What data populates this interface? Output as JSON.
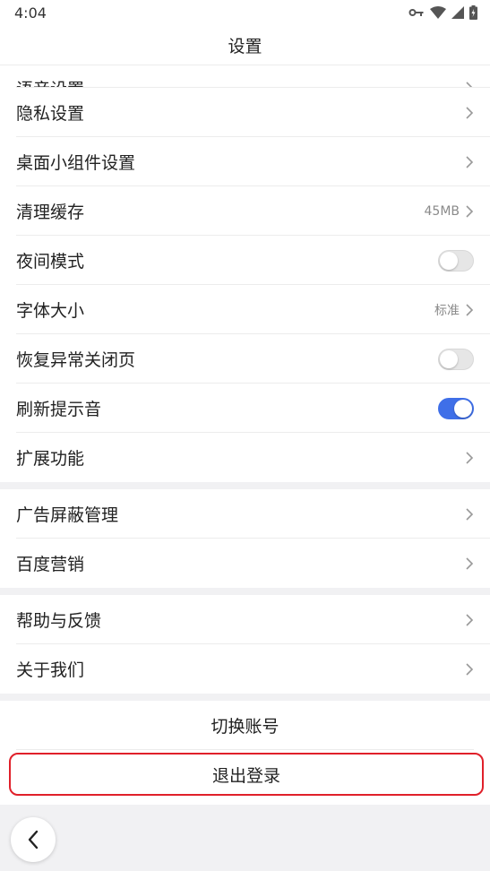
{
  "status_bar": {
    "time": "4:04"
  },
  "header": {
    "title": "设置"
  },
  "settings_group_1": {
    "partial_item": {
      "label": "语音设置"
    },
    "items": [
      {
        "label": "隐私设置",
        "type": "link"
      },
      {
        "label": "桌面小组件设置",
        "type": "link"
      },
      {
        "label": "清理缓存",
        "type": "link",
        "value": "45MB"
      },
      {
        "label": "夜间模式",
        "type": "toggle",
        "checked": false
      },
      {
        "label": "字体大小",
        "type": "link",
        "value": "标准"
      },
      {
        "label": "恢复异常关闭页",
        "type": "toggle",
        "checked": false
      },
      {
        "label": "刷新提示音",
        "type": "toggle",
        "checked": true
      },
      {
        "label": "扩展功能",
        "type": "link"
      }
    ]
  },
  "settings_group_2": {
    "items": [
      {
        "label": "广告屏蔽管理",
        "type": "link"
      },
      {
        "label": "百度营销",
        "type": "link"
      }
    ]
  },
  "settings_group_3": {
    "items": [
      {
        "label": "帮助与反馈",
        "type": "link"
      },
      {
        "label": "关于我们",
        "type": "link"
      }
    ]
  },
  "actions": {
    "switch_account": "切换账号",
    "logout": "退出登录"
  },
  "colors": {
    "accent": "#3f6fe8",
    "highlight_border": "#e0202a",
    "section_gap": "#f1f1f3"
  },
  "icons": {
    "back": "chevron-left-icon",
    "row_arrow": "chevron-right-icon",
    "status": [
      "vpn-key-icon",
      "wifi-icon",
      "signal-icon",
      "battery-charging-icon"
    ]
  }
}
